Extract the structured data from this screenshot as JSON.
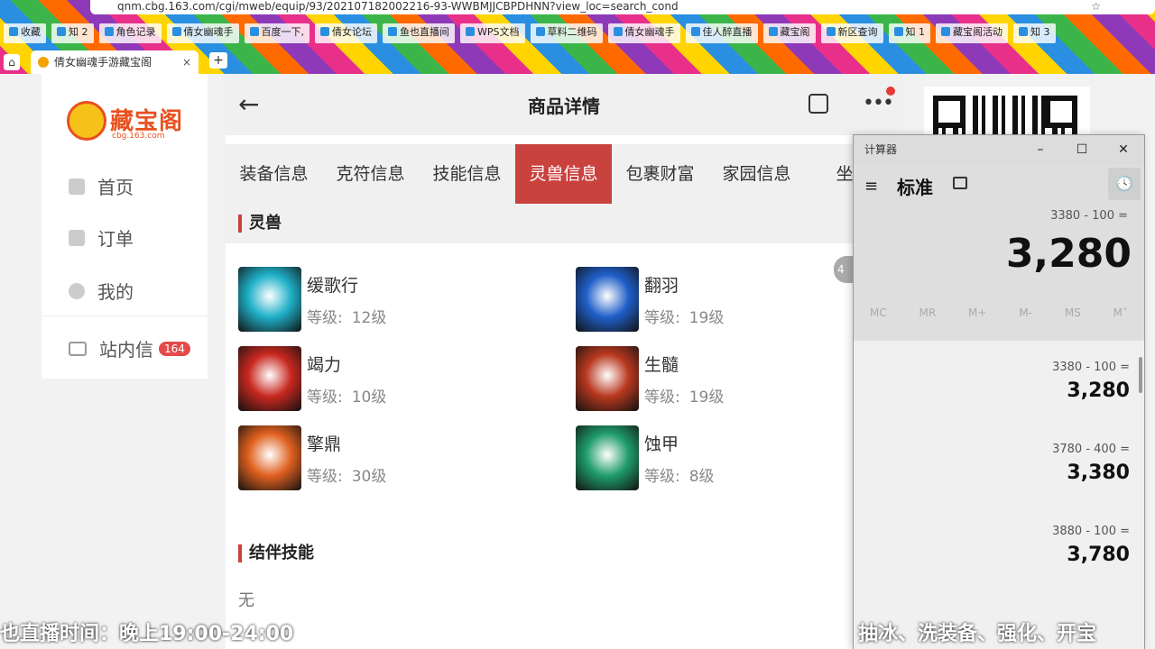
{
  "browser": {
    "url": "qnm.cbg.163.com/cgi/mweb/equip/93/202107182002216-93-WWBMJJCBPDHNN?view_loc=search_cond",
    "bookmarks": [
      "收藏",
      "知 2",
      "角色记录",
      "倩女幽魂手",
      "百度一下,",
      "倩女论坛",
      "鱼也直播间",
      "WPS文档",
      "草料二维码",
      "倩女幽魂手",
      "佳人醉直播",
      "藏宝阁",
      "新区查询",
      "知 1",
      "藏宝阁活动",
      "知 3"
    ],
    "tab_title": "倩女幽魂手游藏宝阁",
    "tab_close": "×",
    "new_tab": "+"
  },
  "sidebar": {
    "logo_text": "藏宝阁",
    "logo_domain": "cbg.163.com",
    "items": [
      {
        "label": "首页"
      },
      {
        "label": "订单"
      },
      {
        "label": "我的"
      },
      {
        "label": "站内信",
        "badge": "164"
      }
    ]
  },
  "header": {
    "back": "←",
    "title": "商品详情",
    "more": "•••"
  },
  "tabs": [
    "装备信息",
    "克符信息",
    "技能信息",
    "灵兽信息",
    "包裹财富",
    "家园信息",
    "坐骑"
  ],
  "active_tab": "灵兽信息",
  "sections": {
    "pets_title": "灵兽",
    "bond_title": "结伴技能",
    "bond_value": "无"
  },
  "level_label": "等级:",
  "pets": [
    {
      "name": "缓歌行",
      "level": "12级",
      "color": "#1fb0c8"
    },
    {
      "name": "翻羽",
      "level": "19级",
      "color": "#1f5fc8"
    },
    {
      "name": "竭力",
      "level": "10级",
      "color": "#c8281f"
    },
    {
      "name": "生髓",
      "level": "19级",
      "color": "#b8381f"
    },
    {
      "name": "擎鼎",
      "level": "30级",
      "color": "#e0601f"
    },
    {
      "name": "蚀甲",
      "level": "8级",
      "color": "#1f9c6a"
    }
  ],
  "scroll_hint": "4",
  "calculator": {
    "window_title": "计算器",
    "min": "–",
    "max": "☐",
    "close": "✕",
    "hamburger": "≡",
    "mode": "标准",
    "expression": "3380 - 100 =",
    "result": "3,280",
    "memory": [
      "MC",
      "MR",
      "M+",
      "M-",
      "MS",
      "M˅"
    ],
    "history": [
      {
        "expr": "3380 -  100 =",
        "result": "3,280"
      },
      {
        "expr": "3780 -  400 =",
        "result": "3,380"
      },
      {
        "expr": "3880 -  100 =",
        "result": "3,780"
      }
    ]
  },
  "ticker": {
    "left": "也直播时间：晚上19:00-24:00",
    "right": "抽冰、洗装备、强化、开宝"
  }
}
